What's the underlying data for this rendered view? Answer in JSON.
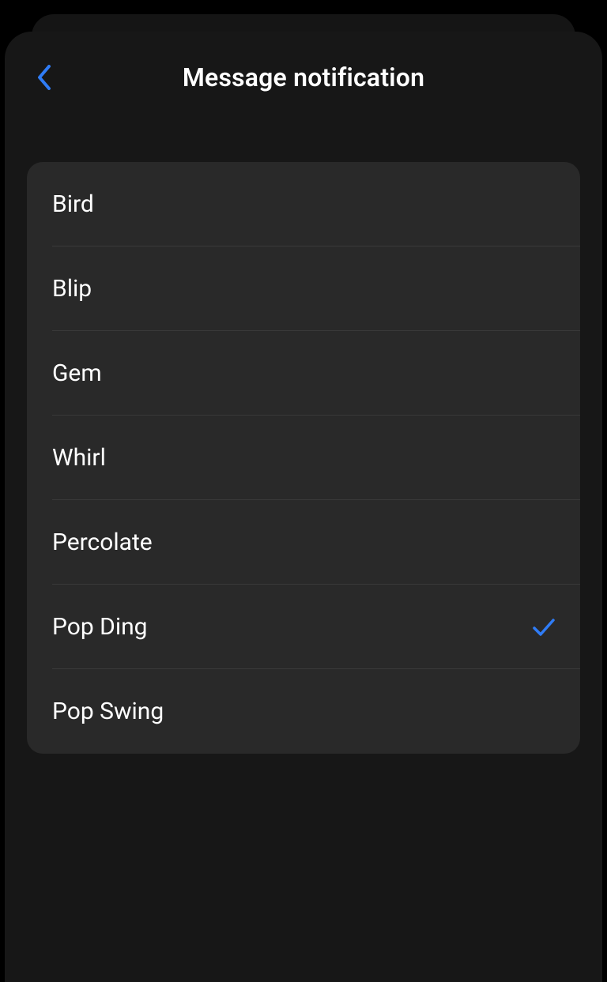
{
  "header": {
    "title": "Message notification"
  },
  "colors": {
    "accent": "#2f7cf6"
  },
  "sounds": {
    "items": [
      {
        "label": "Bird",
        "selected": false
      },
      {
        "label": "Blip",
        "selected": false
      },
      {
        "label": "Gem",
        "selected": false
      },
      {
        "label": "Whirl",
        "selected": false
      },
      {
        "label": "Percolate",
        "selected": false
      },
      {
        "label": "Pop Ding",
        "selected": true
      },
      {
        "label": "Pop Swing",
        "selected": false
      }
    ]
  }
}
